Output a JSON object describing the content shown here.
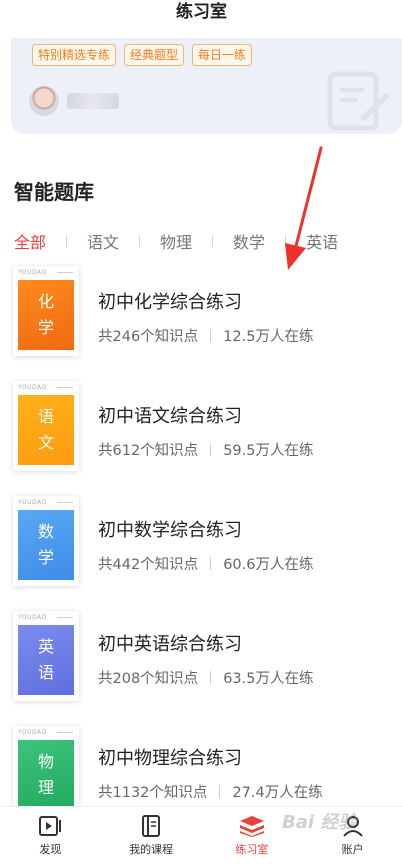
{
  "header": {
    "title": "练习室"
  },
  "banner": {
    "tags": [
      "特别精选专练",
      "经典题型",
      "每日一练"
    ]
  },
  "section": {
    "title": "智能题库"
  },
  "tabs": [
    {
      "label": "全部",
      "active": true
    },
    {
      "label": "语文",
      "active": false
    },
    {
      "label": "物理",
      "active": false
    },
    {
      "label": "数学",
      "active": false
    },
    {
      "label": "英语",
      "active": false
    }
  ],
  "courses": [
    {
      "title": "初中化学综合练习",
      "cover_chars": [
        "化",
        "学"
      ],
      "points": "共246个知识点",
      "learners": "12.5万人在练",
      "color_start": "#ff8a1c",
      "color_end": "#ef6a12"
    },
    {
      "title": "初中语文综合练习",
      "cover_chars": [
        "语",
        "文"
      ],
      "points": "共612个知识点",
      "learners": "59.5万人在练",
      "color_start": "#ffb21a",
      "color_end": "#ff9a10"
    },
    {
      "title": "初中数学综合练习",
      "cover_chars": [
        "数",
        "学"
      ],
      "points": "共442个知识点",
      "learners": "60.6万人在练",
      "color_start": "#5aa8f5",
      "color_end": "#3d8ce8"
    },
    {
      "title": "初中英语综合练习",
      "cover_chars": [
        "英",
        "语"
      ],
      "points": "共208个知识点",
      "learners": "63.5万人在练",
      "color_start": "#7b8cf0",
      "color_end": "#5e6fde"
    },
    {
      "title": "初中物理综合练习",
      "cover_chars": [
        "物",
        "理"
      ],
      "points": "共1132个知识点",
      "learners": "27.4万人在练",
      "color_start": "#3cc57a",
      "color_end": "#21a95e"
    }
  ],
  "book_brand": "YOUDAO",
  "bottom_nav": [
    {
      "label": "发现",
      "icon": "discover-icon",
      "active": false
    },
    {
      "label": "我的课程",
      "icon": "courses-icon",
      "active": false
    },
    {
      "label": "练习室",
      "icon": "practice-icon",
      "active": true
    },
    {
      "label": "账户",
      "icon": "account-icon",
      "active": false
    }
  ],
  "watermark": "Bai 经验",
  "colors": {
    "accent": "#e8413a",
    "tag_orange": "#f07e1d"
  }
}
